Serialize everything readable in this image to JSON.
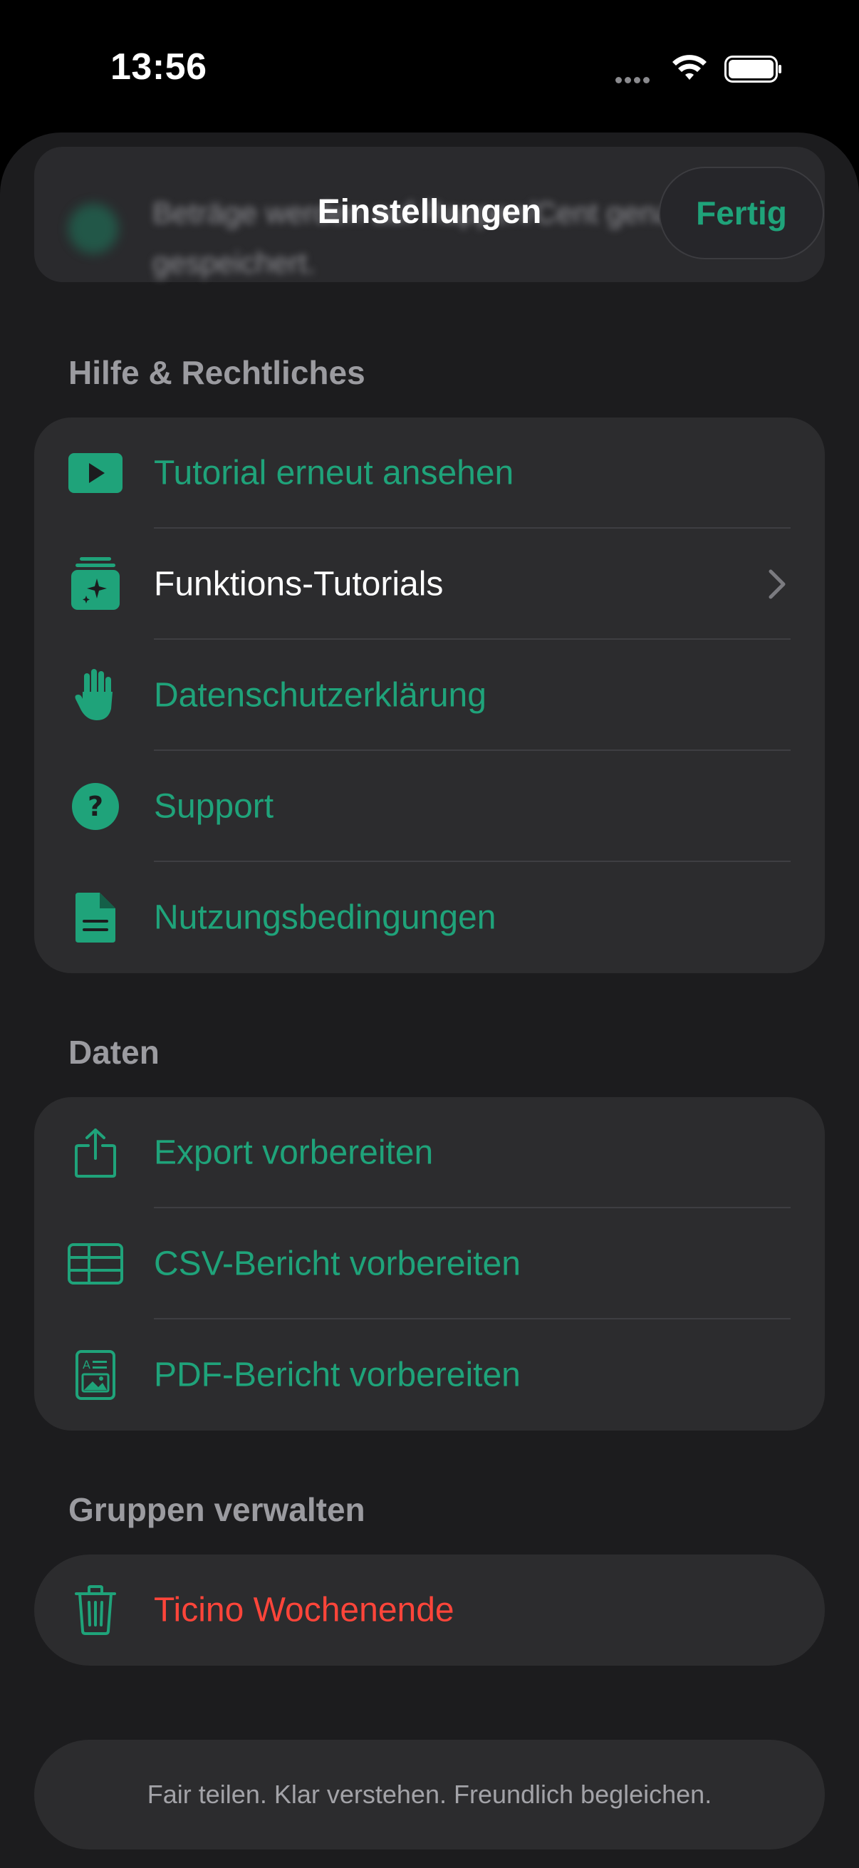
{
  "status_bar": {
    "time": "13:56"
  },
  "header": {
    "title": "Einstellungen",
    "done_label": "Fertig",
    "hint_text": "Beträge werden auf Rappen/Cent genau gespeichert."
  },
  "help_section": {
    "title": "Hilfe & Rechtliches",
    "items": [
      {
        "label": "Tutorial erneut ansehen",
        "icon": "play-rectangle-icon"
      },
      {
        "label": "Funktions-Tutorials",
        "icon": "sparkles-stack-icon"
      },
      {
        "label": "Datenschutzerklärung",
        "icon": "hand-raised-icon"
      },
      {
        "label": "Support",
        "icon": "question-circle-icon"
      },
      {
        "label": "Nutzungsbedingungen",
        "icon": "document-icon"
      }
    ]
  },
  "data_section": {
    "title": "Daten",
    "items": [
      {
        "label": "Export vorbereiten",
        "icon": "share-icon"
      },
      {
        "label": "CSV-Bericht vorbereiten",
        "icon": "table-icon"
      },
      {
        "label": "PDF-Bericht vorbereiten",
        "icon": "pdf-document-icon"
      }
    ]
  },
  "groups_section": {
    "title": "Gruppen verwalten",
    "items": [
      {
        "label": "Ticino Wochenende",
        "icon": "trash-icon"
      }
    ]
  },
  "footer": {
    "tagline": "Fair teilen. Klar verstehen. Freundlich begleichen."
  },
  "colors": {
    "accent": "#1fa37a",
    "destructive": "#ff453a",
    "background": "#1c1c1e",
    "card": "#2c2c2e"
  }
}
